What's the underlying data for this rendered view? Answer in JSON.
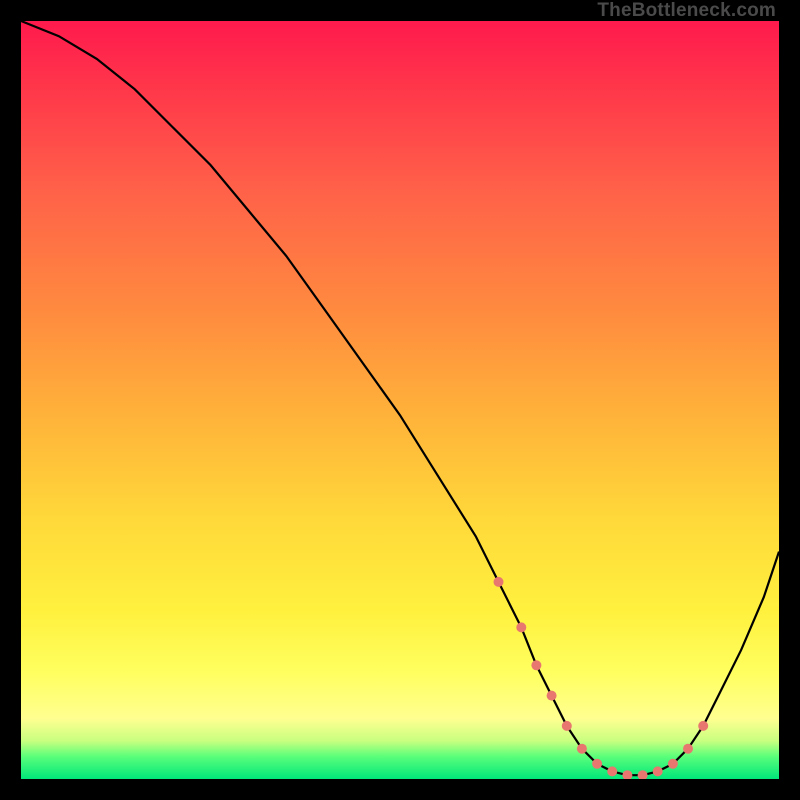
{
  "watermark": "TheBottleneck.com",
  "colors": {
    "gradient_top": "#ff1a4d",
    "gradient_mid1": "#ff8a3f",
    "gradient_mid2": "#ffd93a",
    "gradient_mid3": "#ffff60",
    "gradient_bottom": "#00e67a",
    "curve": "#000000",
    "markers": "#e8786f",
    "frame": "#000000"
  },
  "chart_data": {
    "type": "line",
    "title": "",
    "xlabel": "",
    "ylabel": "",
    "xlim": [
      0,
      100
    ],
    "ylim": [
      0,
      100
    ],
    "grid": false,
    "series": [
      {
        "name": "bottleneck-curve",
        "x": [
          0,
          5,
          10,
          15,
          20,
          25,
          30,
          35,
          40,
          45,
          50,
          55,
          60,
          63,
          66,
          68,
          70,
          72,
          74,
          76,
          78,
          80,
          82,
          84,
          86,
          88,
          90,
          92,
          95,
          98,
          100
        ],
        "values": [
          100,
          98,
          95,
          91,
          86,
          81,
          75,
          69,
          62,
          55,
          48,
          40,
          32,
          26,
          20,
          15,
          11,
          7,
          4,
          2,
          1,
          0.5,
          0.5,
          1,
          2,
          4,
          7,
          11,
          17,
          24,
          30
        ]
      }
    ],
    "markers": {
      "name": "highlight-region",
      "x": [
        63,
        66,
        68,
        70,
        72,
        74,
        76,
        78,
        80,
        82,
        84,
        86,
        88,
        90
      ],
      "values": [
        26,
        20,
        15,
        11,
        7,
        4,
        2,
        1,
        0.5,
        0.5,
        1,
        2,
        4,
        7
      ]
    }
  }
}
